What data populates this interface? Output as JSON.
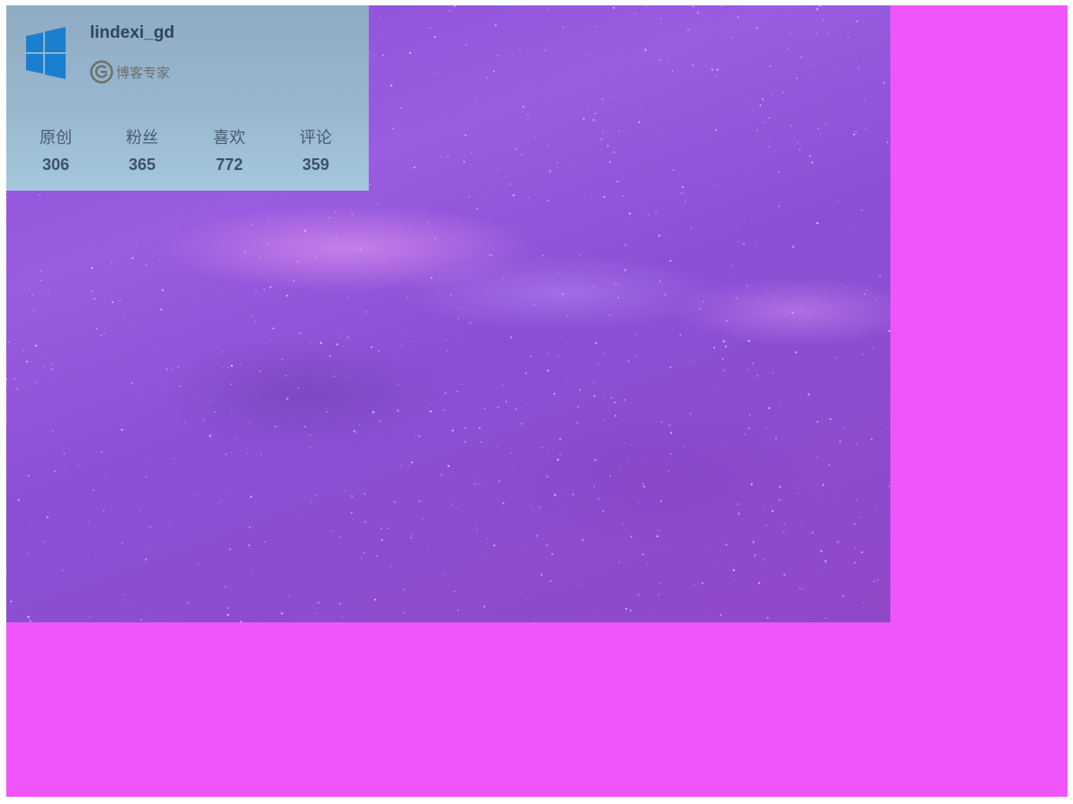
{
  "profile": {
    "username": "lindexi_gd",
    "badge_label": "博客专家",
    "logo_icon": "windows-logo-icon",
    "badge_icon": "blog-expert-icon",
    "stats": [
      {
        "label": "原创",
        "value": "306"
      },
      {
        "label": "粉丝",
        "value": "365"
      },
      {
        "label": "喜欢",
        "value": "772"
      },
      {
        "label": "评论",
        "value": "359"
      }
    ]
  },
  "colors": {
    "canvas_background": "#f055fb",
    "image_background": "#8a4fd8",
    "card_background": "#98b7cf",
    "windows_logo": "#1a7fd0",
    "text_dark": "#2f4660"
  }
}
